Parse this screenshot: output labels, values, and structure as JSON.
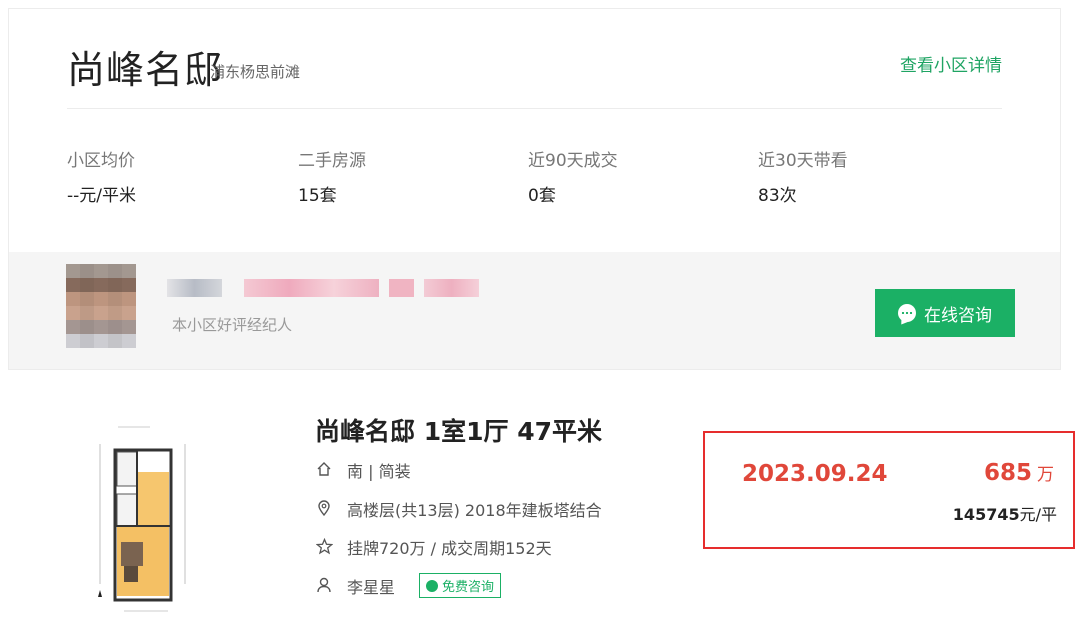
{
  "community": {
    "name": "尚峰名邸",
    "area": "浦东杨思前滩",
    "detail_link": "查看小区详情"
  },
  "stats": [
    {
      "label": "小区均价",
      "value": "--元/平米"
    },
    {
      "label": "二手房源",
      "value": "15套"
    },
    {
      "label": "近90天成交",
      "value": "0套"
    },
    {
      "label": "近30天带看",
      "value": "83次"
    }
  ],
  "agent": {
    "role": "本小区好评经纪人",
    "consult_label": "在线咨询"
  },
  "listing": {
    "title": "尚峰名邸 1室1厅 47平米",
    "orientation": "南 | 简装",
    "floor": "高楼层(共13层) 2018年建板塔结合",
    "listing_info": "挂牌720万 / 成交周期152天",
    "agent_name": "李星星",
    "free_consult": "免费咨询",
    "deal_date": "2023.09.24",
    "deal_price": "685",
    "deal_price_unit": "万",
    "unit_price_value": "145745",
    "unit_price_suffix": "元/平"
  },
  "colors": {
    "green": "#1bb065",
    "red": "#e0473a",
    "highlight_border": "#e62d2d"
  },
  "icons": [
    "home-icon",
    "location-icon",
    "star-icon",
    "user-icon",
    "chat-icon"
  ]
}
